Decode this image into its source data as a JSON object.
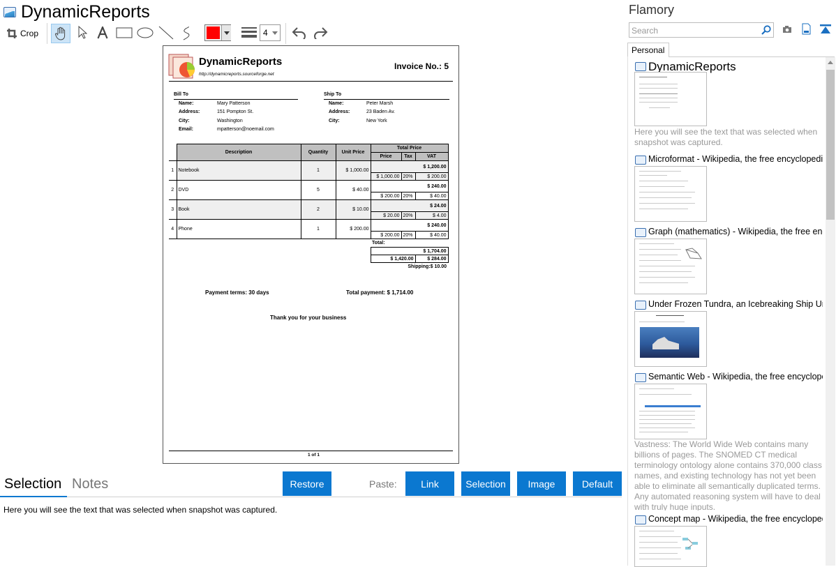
{
  "window": {
    "title": "DynamicReports"
  },
  "toolbar": {
    "crop_label": "Crop",
    "line_width": "4"
  },
  "colors": {
    "accent": "#0b78d0",
    "pen": "#ff0000"
  },
  "document": {
    "brand": "DynamicReports",
    "url": "http://dynamicreports.sourceforge.net",
    "invoice": "Invoice No.: 5",
    "bill_to": {
      "heading": "Bill To",
      "name_label": "Name:",
      "name": "Mary Patterson",
      "address_label": "Address:",
      "address": "151 Pompton St.",
      "city_label": "City:",
      "city": "Washington",
      "email_label": "Email:",
      "email": "mpatterson@noemail.com"
    },
    "ship_to": {
      "heading": "Ship To",
      "name_label": "Name:",
      "name": "Peter Marsh",
      "address_label": "Address:",
      "address": "23 Baden Av.",
      "city_label": "City:",
      "city": "New York"
    },
    "headers": {
      "description": "Description",
      "quantity": "Quantity",
      "unit_price": "Unit Price",
      "total_price": "Total Price",
      "price": "Price",
      "tax": "Tax",
      "vat": "VAT"
    },
    "rows": [
      {
        "n": "1",
        "desc": "Notebook",
        "qty": "1",
        "unit": "$ 1,000.00",
        "total": "$ 1,200.00",
        "price": "$ 1,000.00",
        "tax": "20%",
        "vat": "$ 200.00"
      },
      {
        "n": "2",
        "desc": "DVD",
        "qty": "5",
        "unit": "$ 40.00",
        "total": "$ 240.00",
        "price": "$ 200.00",
        "tax": "20%",
        "vat": "$ 40.00"
      },
      {
        "n": "3",
        "desc": "Book",
        "qty": "2",
        "unit": "$ 10.00",
        "total": "$ 24.00",
        "price": "$ 20.00",
        "tax": "20%",
        "vat": "$ 4.00"
      },
      {
        "n": "4",
        "desc": "Phone",
        "qty": "1",
        "unit": "$ 200.00",
        "total": "$ 240.00",
        "price": "$ 200.00",
        "tax": "20%",
        "vat": "$ 40.00"
      }
    ],
    "total_label": "Total:",
    "total": "$ 1,704.00",
    "total_price": "$ 1,420.00",
    "total_vat": "$ 284.00",
    "shipping": "Shipping:$ 10.00",
    "payment_terms": "Payment terms: 30 days",
    "total_payment": "Total payment: $ 1,714.00",
    "thanks": "Thank you for your business",
    "page": "1 of 1"
  },
  "bottom": {
    "tabs": [
      "Selection",
      "Notes"
    ],
    "restore": "Restore",
    "paste_label": "Paste:",
    "paste_buttons": [
      "Link",
      "Selection",
      "Image",
      "Default"
    ],
    "selection_text": "Here you will see the text that was selected when snapshot was captured."
  },
  "sidebar": {
    "title": "Flamory",
    "search_placeholder": "Search",
    "tab": "Personal",
    "items": [
      {
        "title": "DynamicReports",
        "desc": "Here you will see the text that was selected when snapshot was captured."
      },
      {
        "title": "Microformat - Wikipedia, the free encyclopedia"
      },
      {
        "title": "Graph (mathematics) - Wikipedia, the free encyclopedia"
      },
      {
        "title": "Under Frozen Tundra, an Icebreaking Ship Uncovers"
      },
      {
        "title": "Semantic Web - Wikipedia, the free encyclopedia",
        "desc": "Vastness: The World Wide Web contains many billions of pages. The SNOMED CT medical terminology ontology alone contains 370,000 class names, and existing technology has not yet been able to eliminate all semantically duplicated terms. Any automated reasoning system will have to deal with truly huge inputs."
      },
      {
        "title": "Concept map - Wikipedia, the free encyclopedia"
      }
    ]
  }
}
